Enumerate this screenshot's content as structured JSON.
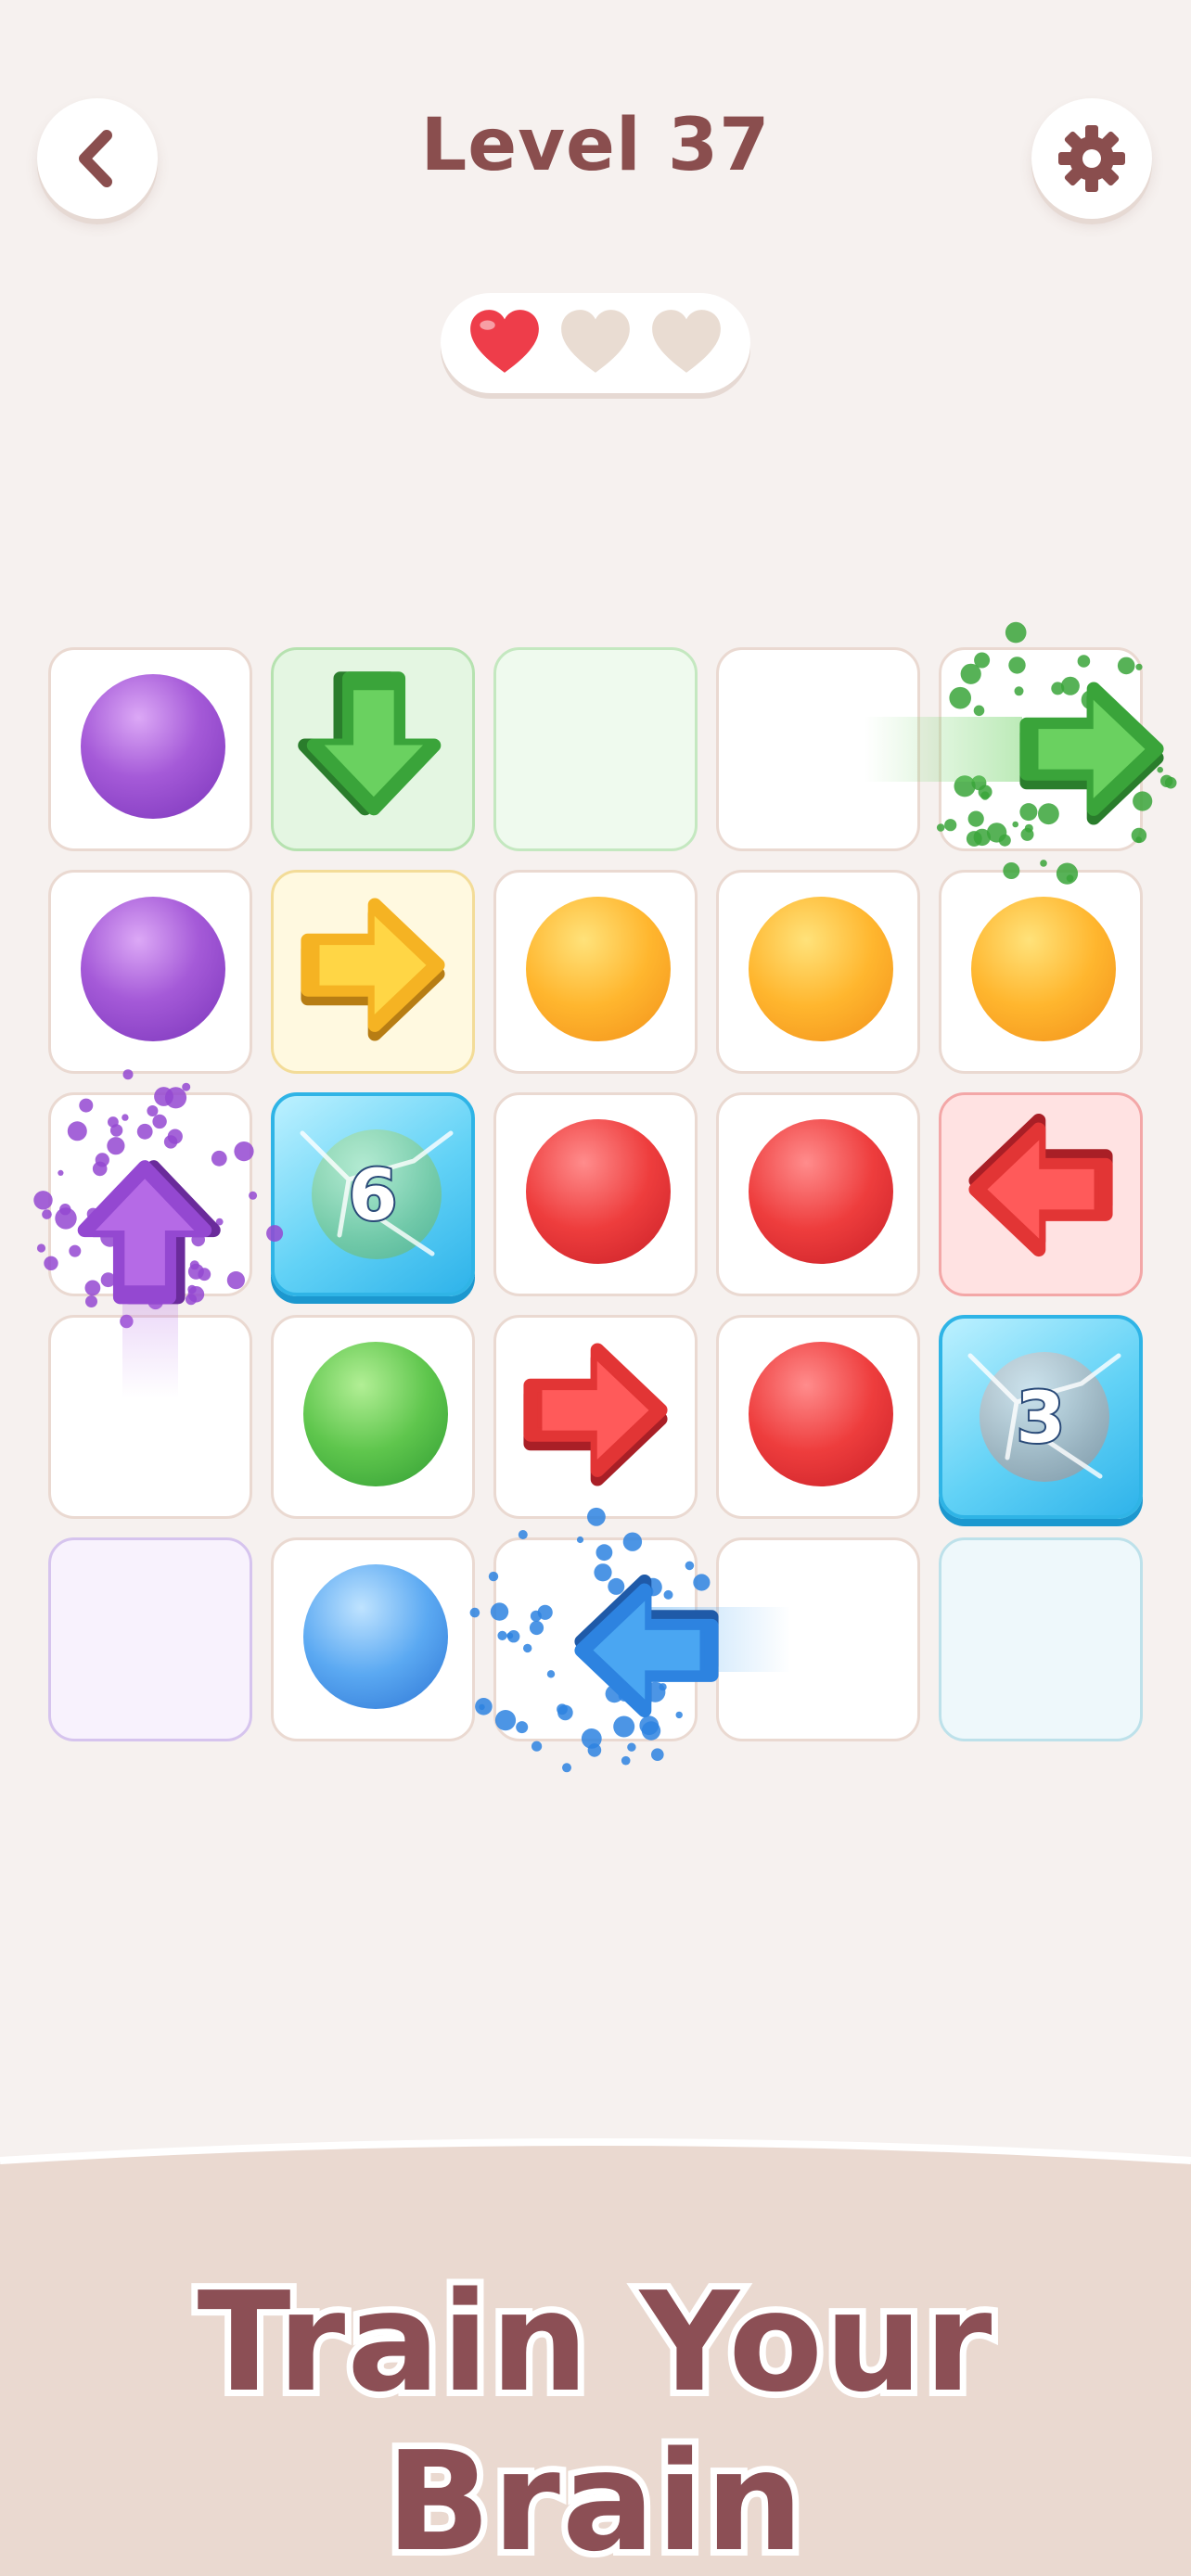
{
  "header": {
    "title": "Level 37",
    "back_icon": "chevron-left-icon",
    "settings_icon": "gear-icon"
  },
  "lives": {
    "total": 3,
    "remaining": 1,
    "full_color": "#ee3d4a",
    "empty_color": "#e9dcd2"
  },
  "board": {
    "rows": 5,
    "cols": 5,
    "cells": [
      [
        {
          "type": "ball",
          "color": "purple"
        },
        {
          "type": "arrow",
          "color": "green",
          "direction": "down",
          "bg": "green"
        },
        {
          "type": "empty",
          "bg": "green-light"
        },
        {
          "type": "empty",
          "bg": "plain"
        },
        {
          "type": "empty",
          "bg": "plain"
        }
      ],
      [
        {
          "type": "ball",
          "color": "purple"
        },
        {
          "type": "arrow",
          "color": "yellow",
          "direction": "right",
          "bg": "yellow"
        },
        {
          "type": "ball",
          "color": "orange"
        },
        {
          "type": "ball",
          "color": "orange"
        },
        {
          "type": "ball",
          "color": "orange"
        }
      ],
      [
        {
          "type": "empty",
          "bg": "plain"
        },
        {
          "type": "ice",
          "ball": "green",
          "count": "6"
        },
        {
          "type": "ball",
          "color": "red"
        },
        {
          "type": "ball",
          "color": "red"
        },
        {
          "type": "arrow",
          "color": "red",
          "direction": "left",
          "bg": "red"
        }
      ],
      [
        {
          "type": "empty",
          "bg": "plain"
        },
        {
          "type": "ball",
          "color": "green"
        },
        {
          "type": "arrow",
          "color": "red",
          "direction": "right",
          "bg": "plain"
        },
        {
          "type": "ball",
          "color": "red"
        },
        {
          "type": "ice",
          "ball": "gray",
          "count": "3"
        }
      ],
      [
        {
          "type": "empty",
          "bg": "purple-light"
        },
        {
          "type": "ball",
          "color": "blue"
        },
        {
          "type": "empty",
          "bg": "plain"
        },
        {
          "type": "empty",
          "bg": "plain"
        },
        {
          "type": "empty",
          "bg": "cyan-light"
        }
      ]
    ],
    "moving_arrows": [
      {
        "color": "green",
        "direction": "right",
        "near_row": 0,
        "near_col": 4
      },
      {
        "color": "purple",
        "direction": "up",
        "near_row": 2,
        "near_col": 0
      },
      {
        "color": "blue",
        "direction": "left",
        "near_row": 4,
        "near_col": 2
      }
    ]
  },
  "palette": {
    "green": [
      "#6ad160",
      "#3aa43a",
      "#2a7d2c"
    ],
    "yellow": [
      "#ffd645",
      "#f5b323",
      "#b77d14"
    ],
    "red": [
      "#ff5a5a",
      "#e23535",
      "#a91f26"
    ],
    "purple": [
      "#b56ae6",
      "#9448d1",
      "#6a2b9b"
    ],
    "blue": [
      "#4aa6f2",
      "#2d83e0",
      "#1f5aa8"
    ]
  },
  "banner": {
    "tagline": "Train Your Brain"
  }
}
